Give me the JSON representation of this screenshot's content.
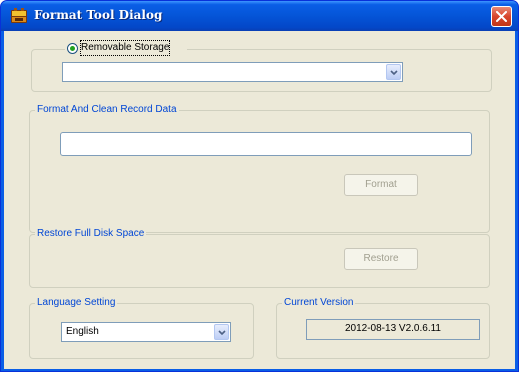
{
  "window": {
    "title": "Format Tool Dialog",
    "icon": "app-icon"
  },
  "storage": {
    "radio_label": "Removable Storage",
    "selected": true,
    "device_value": ""
  },
  "format_group": {
    "legend": "Format And Clean Record Data",
    "path_value": "",
    "button_label": "Format",
    "button_enabled": false
  },
  "restore_group": {
    "legend": "Restore Full Disk Space",
    "button_label": "Restore",
    "button_enabled": false
  },
  "language_group": {
    "legend": "Language Setting",
    "selected": "English"
  },
  "version_group": {
    "legend": "Current Version",
    "value": "2012-08-13 V2.0.6.11"
  },
  "colors": {
    "title_bar": "#0a5ee6",
    "close_button": "#d8452c",
    "dialog_bg": "#ece9d8",
    "legend_text": "#0046d5"
  }
}
